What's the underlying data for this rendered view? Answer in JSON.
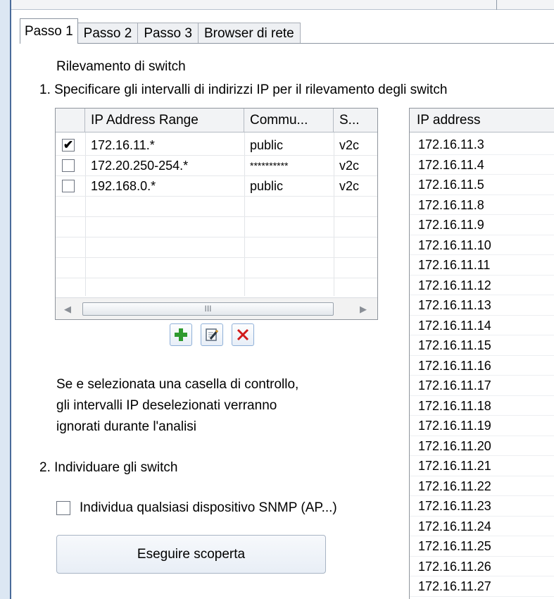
{
  "tabs": [
    {
      "label": "Passo 1",
      "active": true
    },
    {
      "label": "Passo 2",
      "active": false
    },
    {
      "label": "Passo 3",
      "active": false
    },
    {
      "label": "Browser di rete",
      "active": false
    }
  ],
  "section_title": "Rilevamento di switch",
  "step1_label": "1. Specificare gli intervalli di indirizzi IP per il rilevamento degli switch",
  "range_table": {
    "headers": [
      "IP Address Range",
      "Commu...",
      "S..."
    ],
    "rows": [
      {
        "checked": true,
        "range": "172.16.11.*",
        "community": "public",
        "version": "v2c"
      },
      {
        "checked": false,
        "range": "172.20.250-254.*",
        "community": "**********",
        "version": "v2c"
      },
      {
        "checked": false,
        "range": "192.168.0.*",
        "community": "public",
        "version": "v2c"
      }
    ],
    "scroll_thumb_grip": "III"
  },
  "toolbar": {
    "add_icon": "plus-icon",
    "edit_icon": "edit-icon",
    "delete_icon": "delete-x-icon"
  },
  "note": {
    "line1": "Se e selezionata una casella di controllo,",
    "line2": "gli intervalli IP deselezionati verranno",
    "line3": "ignorati durante l'analisi"
  },
  "step2_label": "2. Individuare gli switch",
  "snmp_checkbox": {
    "label": "Individua qualsiasi dispositivo SNMP (AP...)",
    "checked": false
  },
  "run_button": "Eseguire scoperta",
  "ip_list": {
    "header": "IP address",
    "items": [
      "172.16.11.3",
      "172.16.11.4",
      "172.16.11.5",
      "172.16.11.8",
      "172.16.11.9",
      "172.16.11.10",
      "172.16.11.11",
      "172.16.11.12",
      "172.16.11.13",
      "172.16.11.14",
      "172.16.11.15",
      "172.16.11.16",
      "172.16.11.17",
      "172.16.11.18",
      "172.16.11.19",
      "172.16.11.20",
      "172.16.11.21",
      "172.16.11.22",
      "172.16.11.23",
      "172.16.11.24",
      "172.16.11.25",
      "172.16.11.26",
      "172.16.11.27"
    ]
  },
  "colors": {
    "accent_green": "#2f9a2f",
    "delete_red": "#d11a1a",
    "button_border": "#8fb0d8"
  }
}
